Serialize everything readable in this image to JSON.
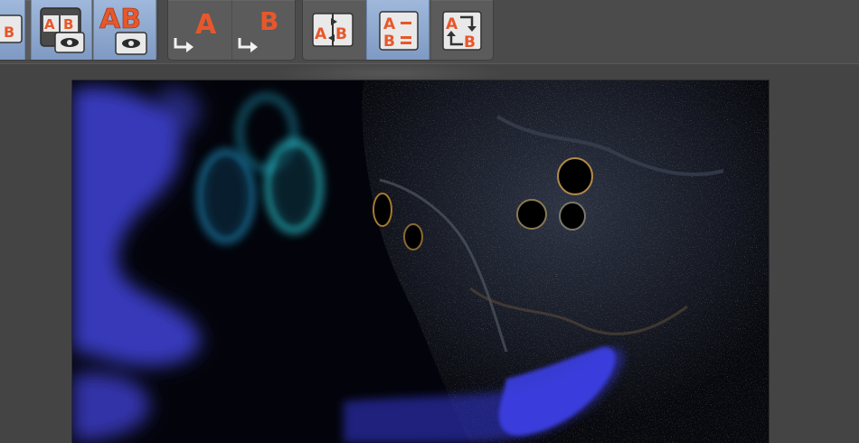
{
  "toolbar": {
    "buttons": [
      {
        "id": "show-b",
        "letters": [
          "B"
        ],
        "active": true
      },
      {
        "id": "ab-with-preview",
        "letters": [
          "A",
          "B"
        ],
        "active": true
      },
      {
        "id": "ab-large-preview",
        "letters": [
          "AB"
        ],
        "active": true
      },
      {
        "id": "copy-to-a",
        "letters": [
          "A"
        ],
        "active": false
      },
      {
        "id": "copy-to-b",
        "letters": [
          "B"
        ],
        "active": false
      },
      {
        "id": "swap-ab-split",
        "letters": [
          "A",
          "B"
        ],
        "active": false
      },
      {
        "id": "difference-ab",
        "letters": [
          "A",
          "B"
        ],
        "active": true
      },
      {
        "id": "swap-ab-rotate",
        "letters": [
          "A",
          "B"
        ],
        "active": false
      }
    ]
  },
  "icons": {
    "arrow": "right-arrow-icon",
    "eye": "eye-icon",
    "minus": "minus-icon",
    "equals": "equals-icon",
    "swap": "swap-arrows-icon"
  },
  "colors": {
    "accent_letter": "#e8572a",
    "active_button": "#8ea8cf",
    "toolbar": "#5b5b5b",
    "background": "#444444",
    "viewport": "#05060d"
  },
  "viewport": {
    "content": "difference-render-image"
  }
}
